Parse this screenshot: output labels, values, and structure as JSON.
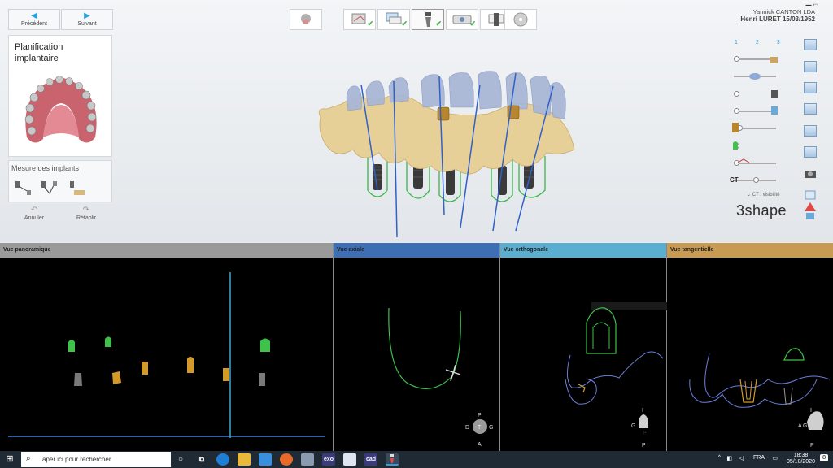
{
  "nav": {
    "previous_label": "Précédent",
    "next_label": "Suivant"
  },
  "plan": {
    "title": "Planification implantaire"
  },
  "measure": {
    "title": "Mesure des implants"
  },
  "history": {
    "undo_label": "Annuler",
    "redo_label": "Rétablir"
  },
  "patient": {
    "operator": "Yannick CANTON LDA",
    "name": "Henri LURET 15/03/1952"
  },
  "layers": {
    "tabs": [
      "1",
      "2",
      "3"
    ],
    "ct_label": "CT",
    "ct_visibility": "CT : visibilité"
  },
  "brand": "3shape",
  "views": [
    {
      "title": "Vue panoramique",
      "color": "#9a9a9a"
    },
    {
      "title": "Vue axiale",
      "color": "#3e6fb5"
    },
    {
      "title": "Vue orthogonale",
      "color": "#5aaecf"
    },
    {
      "title": "Vue tangentielle",
      "color": "#c89a52"
    }
  ],
  "orientation": {
    "axial": [
      "P",
      "D",
      "T",
      "G",
      "A"
    ],
    "orthogonal": [
      "I",
      "G",
      "P",
      "P"
    ],
    "tangential": [
      "I",
      "A",
      "G",
      "P"
    ]
  },
  "taskbar": {
    "search_placeholder": "Taper ici pour rechercher",
    "app_exo": "exo",
    "app_cad": "cad",
    "language": "FRA",
    "time": "18:38",
    "date": "05/10/2020",
    "notifications": "8"
  },
  "colors": {
    "accent": "#29a3e0",
    "implant_green": "#3ec24a",
    "implant_gold": "#d39a2a",
    "gum": "#e7cf98",
    "crown": "#a9b7d6"
  }
}
